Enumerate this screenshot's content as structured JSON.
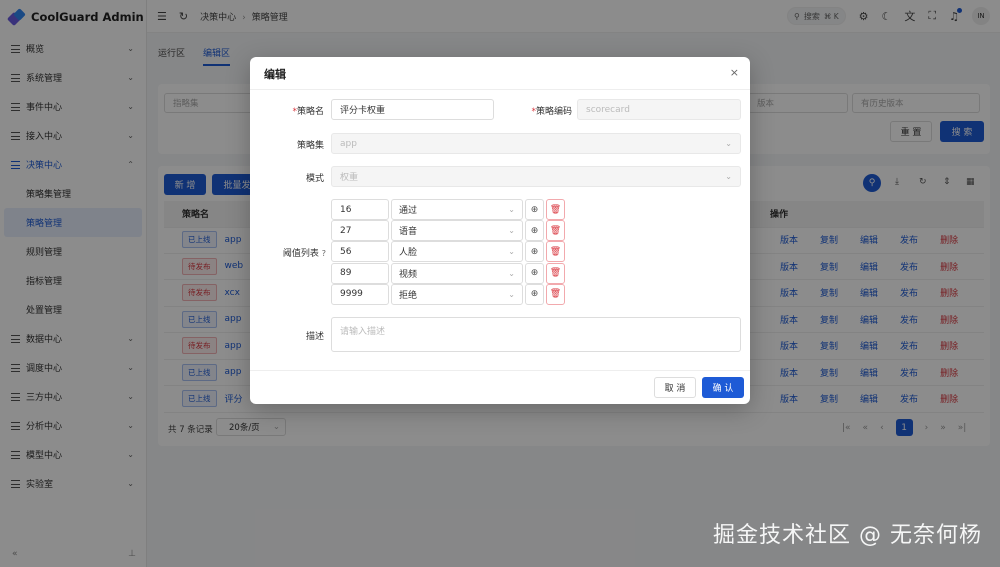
{
  "app": {
    "title": "CoolGuard Admin"
  },
  "sidebar": {
    "items": [
      {
        "label": "概览",
        "chev": "⌄"
      },
      {
        "label": "系统管理",
        "chev": "⌄"
      },
      {
        "label": "事件中心",
        "chev": "⌄"
      },
      {
        "label": "接入中心",
        "chev": "⌄"
      },
      {
        "label": "决策中心",
        "chev": "⌃",
        "open": true
      },
      {
        "label": "数据中心",
        "chev": "⌄"
      },
      {
        "label": "调度中心",
        "chev": "⌄"
      },
      {
        "label": "三方中心",
        "chev": "⌄"
      },
      {
        "label": "分析中心",
        "chev": "⌄"
      },
      {
        "label": "模型中心",
        "chev": "⌄"
      },
      {
        "label": "实验室",
        "chev": "⌄"
      }
    ],
    "sub_items": [
      "策略集管理",
      "策略管理",
      "规则管理",
      "指标管理",
      "处置管理"
    ],
    "collapse_icon": "«",
    "pin_icon": "⊥"
  },
  "header": {
    "breadcrumb": [
      "决策中心",
      "策略管理"
    ],
    "search_label": "搜索",
    "search_shortcut": "⌘ K",
    "avatar": "IN"
  },
  "tabs": [
    "运行区",
    "编辑区"
  ],
  "filter": {
    "placeholder1": "指略集",
    "placeholder2": "版本",
    "placeholder3": "有历史版本",
    "reset": "重 置",
    "search": "搜 索"
  },
  "table": {
    "add": "新 增",
    "batch": "批量发",
    "col_name": "策略名",
    "col_ops": "操作",
    "rows": [
      {
        "status": "已上线",
        "s": "on",
        "name": "app"
      },
      {
        "status": "待发布",
        "s": "pend",
        "name": "web"
      },
      {
        "status": "待发布",
        "s": "pend",
        "name": "xcx"
      },
      {
        "status": "已上线",
        "s": "on",
        "name": "app"
      },
      {
        "status": "待发布",
        "s": "pend",
        "name": "app"
      },
      {
        "status": "已上线",
        "s": "on",
        "name": "app"
      },
      {
        "status": "已上线",
        "s": "on",
        "name": "评分"
      }
    ],
    "ops": [
      "版本",
      "复制",
      "编辑",
      "发布",
      "删除"
    ],
    "total": "共 7 条记录",
    "page_size": "20条/页",
    "current_page": "1"
  },
  "modal": {
    "title": "编辑",
    "close": "×",
    "name_label": "策略名",
    "name_value": "评分卡权重",
    "code_label": "策略编码",
    "code_value": "scorecard",
    "set_label": "策略集",
    "set_value": "app",
    "mode_label": "模式",
    "mode_value": "权重",
    "threshold_label": "阈值列表",
    "thresholds": [
      {
        "value": "16",
        "action": "通过"
      },
      {
        "value": "27",
        "action": "语音"
      },
      {
        "value": "56",
        "action": "人脸"
      },
      {
        "value": "89",
        "action": "视频"
      },
      {
        "value": "9999",
        "action": "拒绝"
      }
    ],
    "desc_label": "描述",
    "desc_placeholder": "请输入描述",
    "cancel": "取 消",
    "ok": "确 认"
  },
  "watermark": "掘金技术社区 @ 无奈何杨",
  "colors": {
    "primary": "#1e5bd6",
    "danger": "#d9363e"
  }
}
